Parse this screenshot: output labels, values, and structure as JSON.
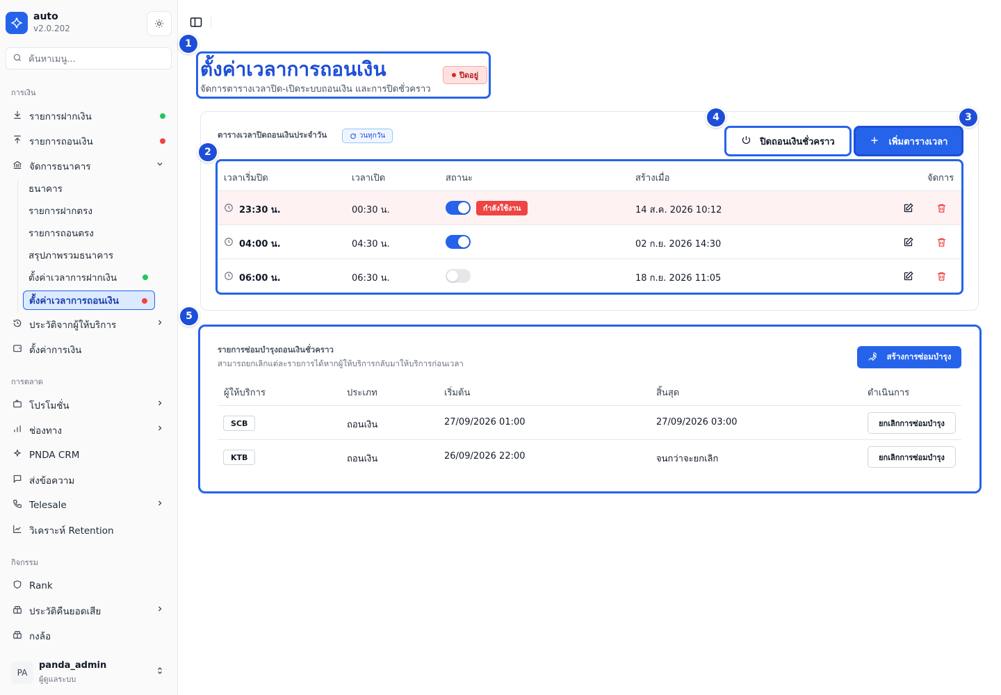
{
  "brand": {
    "name": "auto",
    "version": "v2.0.202"
  },
  "search": {
    "placeholder": "ค้นหาเมนู..."
  },
  "sidebar": {
    "sections": {
      "finance": "การเงิน",
      "marketing": "การตลาด",
      "activities": "กิจกรรม"
    },
    "items": {
      "deposits": "รายการฝากเงิน",
      "withdrawals": "รายการถอนเงิน",
      "bank_mgmt": "จัดการธนาคาร",
      "banks": "ธนาคาร",
      "direct_deposits": "รายการฝากตรง",
      "direct_withdrawals": "รายการถอนตรง",
      "bank_summary": "สรุปภาพรวมธนาคาร",
      "deposit_schedule": "ตั้งค่าเวลาการฝากเงิน",
      "withdraw_schedule": "ตั้งค่าเวลาการถอนเงิน",
      "provider_history": "ประวัติจากผู้ให้บริการ",
      "finance_settings": "ตั้งค่าการเงิน",
      "promotions": "โปรโมชั่น",
      "channels": "ช่องทาง",
      "crm": "PNDA CRM",
      "messages": "ส่งข้อความ",
      "telesale": "Telesale",
      "retention": "วิเคราะห์ Retention",
      "rank": "Rank",
      "cashback_history": "ประวัติคืนยอดเสีย",
      "wheel": "กงล้อ"
    },
    "dot_colors": {
      "green": "#22c55e",
      "red": "#ef4444"
    }
  },
  "user": {
    "initials": "PA",
    "name": "panda_admin",
    "role": "ผู้ดูแลระบบ"
  },
  "page": {
    "title": "ตั้งค่าเวลาการถอนเงิน",
    "subtitle": "จัดการตารางเวลาปิด-เปิดระบบถอนเงิน และการปิดชั่วคราว",
    "status": "ปิดอยู่"
  },
  "annotations": [
    "1",
    "2",
    "3",
    "4",
    "5"
  ],
  "schedule": {
    "title": "ตารางเวลาปิดถอนเงินประจำวัน",
    "daily_badge": "วนทุกวัน",
    "temp_close_button": "ปิดถอนเงินชั่วคราว",
    "add_button": "เพิ่มตารางเวลา",
    "columns": [
      "เวลาเริ่มปิด",
      "เวลาเปิด",
      "สถานะ",
      "สร้างเมื่อ",
      "จัดการ"
    ],
    "active_label": "กำลังใช้งาน",
    "rows": [
      {
        "start": "23:30 น.",
        "end": "00:30 น.",
        "enabled": true,
        "active": true,
        "created": "14 ส.ค. 2026 10:12"
      },
      {
        "start": "04:00 น.",
        "end": "04:30 น.",
        "enabled": true,
        "active": false,
        "created": "02 ก.ย. 2026 14:30"
      },
      {
        "start": "06:00 น.",
        "end": "06:30 น.",
        "enabled": false,
        "active": false,
        "created": "18 ก.ย. 2026 11:05"
      }
    ]
  },
  "maintenance": {
    "title": "รายการซ่อมบำรุงถอนเงินชั่วคราว",
    "subtitle": "สามารถยกเลิกแต่ละรายการได้หากผู้ให้บริการกลับมาให้บริการก่อนเวลา",
    "create_button": "สร้างการซ่อมบำรุง",
    "columns": [
      "ผู้ให้บริการ",
      "ประเภท",
      "เริ่มต้น",
      "สิ้นสุด",
      "ดำเนินการ"
    ],
    "cancel_label": "ยกเลิกการซ่อมบำรุง",
    "rows": [
      {
        "provider": "SCB",
        "type": "ถอนเงิน",
        "start": "27/09/2026 01:00",
        "end": "27/09/2026 03:00"
      },
      {
        "provider": "KTB",
        "type": "ถอนเงิน",
        "start": "26/09/2026 22:00",
        "end": "จนกว่าจะยกเลิก"
      }
    ]
  },
  "colors": {
    "accent": "#2563eb",
    "danger": "#ef4444",
    "success": "#22c55e"
  }
}
